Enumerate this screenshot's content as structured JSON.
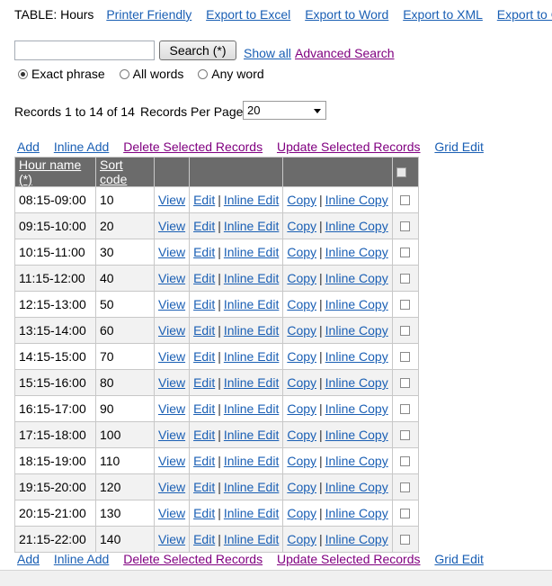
{
  "topbar": {
    "table_name": "TABLE: Hours",
    "links": [
      "Printer Friendly",
      "Export to Excel",
      "Export to Word",
      "Export to XML",
      "Export to CSV"
    ]
  },
  "search": {
    "value": "",
    "button_label": "Search (*)",
    "show_all": "Show all",
    "advanced": "Advanced Search",
    "options": [
      "Exact phrase",
      "All words",
      "Any word"
    ],
    "selected_option": "Exact phrase"
  },
  "records": {
    "info": "Records 1 to 14 of 14",
    "per_page_label": "Records Per Page",
    "per_page_value": "20"
  },
  "actions": {
    "add": "Add",
    "inline_add": "Inline Add",
    "delete_selected": "Delete Selected Records",
    "update_selected": "Update Selected Records",
    "grid_edit": "Grid Edit"
  },
  "grid": {
    "columns": [
      "Hour name (*)",
      "Sort code"
    ],
    "row_links": {
      "view": "View",
      "edit": "Edit",
      "inline_edit": "Inline Edit",
      "copy": "Copy",
      "inline_copy": "Inline Copy",
      "separator": "|"
    },
    "rows": [
      {
        "hour": "08:15-09:00",
        "sort": "10"
      },
      {
        "hour": "09:15-10:00",
        "sort": "20"
      },
      {
        "hour": "10:15-11:00",
        "sort": "30"
      },
      {
        "hour": "11:15-12:00",
        "sort": "40"
      },
      {
        "hour": "12:15-13:00",
        "sort": "50"
      },
      {
        "hour": "13:15-14:00",
        "sort": "60"
      },
      {
        "hour": "14:15-15:00",
        "sort": "70"
      },
      {
        "hour": "15:15-16:00",
        "sort": "80"
      },
      {
        "hour": "16:15-17:00",
        "sort": "90"
      },
      {
        "hour": "17:15-18:00",
        "sort": "100"
      },
      {
        "hour": "18:15-19:00",
        "sort": "110"
      },
      {
        "hour": "19:15-20:00",
        "sort": "120"
      },
      {
        "hour": "20:15-21:00",
        "sort": "130"
      },
      {
        "hour": "21:15-22:00",
        "sort": "140"
      }
    ]
  },
  "colors": {
    "link": "#1a5fb4",
    "visited_link": "#800080",
    "header_bg": "#6b6b6b",
    "alt_row_bg": "#f2f2f2"
  }
}
